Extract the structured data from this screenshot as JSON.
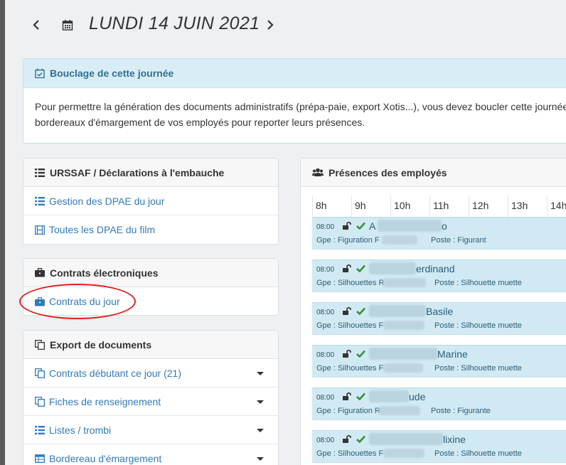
{
  "header": {
    "date_title": "LUNDI 14 JUIN 2021"
  },
  "info": {
    "title": "Bouclage de cette journée",
    "line1": "Pour permettre la génération des documents administratifs (prépa-paie, export Xotis...), vous devez boucler cette journée",
    "line2": "bordereaux d'émargement de vos employés pour reporter leurs présences."
  },
  "urssaf": {
    "title": "URSSAF / Déclarations à l'embauche",
    "items": [
      {
        "label": "Gestion des DPAE du jour",
        "icon": "list-icon"
      },
      {
        "label": "Toutes les DPAE du film",
        "icon": "film-icon"
      }
    ]
  },
  "contrats": {
    "title": "Contrats électroniques",
    "items": [
      {
        "label": "Contrats du jour",
        "icon": "briefcase-icon"
      }
    ]
  },
  "export": {
    "title": "Export de documents",
    "items": [
      {
        "label": "Contrats débutant ce jour (21)",
        "icon": "copy-icon"
      },
      {
        "label": "Fiches de renseignement",
        "icon": "copy-icon"
      },
      {
        "label": "Listes / trombi",
        "icon": "list-icon"
      },
      {
        "label": "Bordereau d'émargement",
        "icon": "table-icon"
      }
    ]
  },
  "presences": {
    "title": "Présences des employés",
    "hours": [
      "8h",
      "9h",
      "10h",
      "11h",
      "12h",
      "13h",
      "14h"
    ],
    "employees": [
      {
        "time": "08:00",
        "name_start": "A",
        "name_end": "o",
        "group": "Gpe : Figuration F",
        "post": "Poste : Figurant"
      },
      {
        "time": "08:00",
        "name_start": "",
        "name_end": "erdinand",
        "group": "Gpe : Silhouettes R",
        "post": "Poste : Silhouette muette"
      },
      {
        "time": "08:00",
        "name_start": "",
        "name_end": "Basile",
        "group": "Gpe : Silhouettes F",
        "post": "Poste : Silhouette muette"
      },
      {
        "time": "08:00",
        "name_start": "",
        "name_end": "Marine",
        "group": "Gpe : Silhouettes F",
        "post": "Poste : Silhouette muette"
      },
      {
        "time": "08:00",
        "name_start": "",
        "name_end": "ude",
        "group": "Gpe : Figuration R",
        "post": "Poste : Figurante"
      },
      {
        "time": "08:00",
        "name_start": "",
        "name_end": "lixine",
        "group": "Gpe : Silhouettes F",
        "post": "Poste : Silhouette muette"
      }
    ]
  },
  "colors": {
    "link": "#337ab7",
    "info_bg": "#d9edf7",
    "row_bg": "#d1e9f2",
    "check": "#3c8d3c",
    "annotation": "#e02020"
  }
}
